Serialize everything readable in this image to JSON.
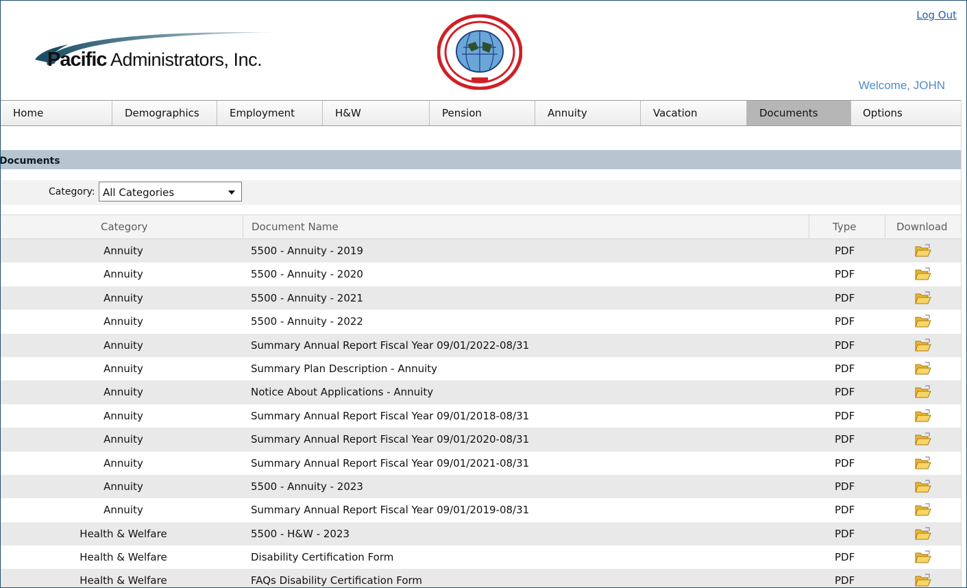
{
  "header": {
    "logo_bold": "Pacific",
    "logo_rest": " Administrators, Inc.",
    "logout": "Log Out",
    "welcome": "Welcome, JOHN"
  },
  "nav": [
    {
      "label": "Home",
      "active": false
    },
    {
      "label": "Demographics",
      "active": false
    },
    {
      "label": "Employment",
      "active": false
    },
    {
      "label": "H&W",
      "active": false
    },
    {
      "label": "Pension",
      "active": false
    },
    {
      "label": "Annuity",
      "active": false
    },
    {
      "label": "Vacation",
      "active": false
    },
    {
      "label": "Documents",
      "active": true
    },
    {
      "label": "Options",
      "active": false
    }
  ],
  "section": {
    "title": "Documents"
  },
  "filter": {
    "label": "Category:",
    "value": "All Categories"
  },
  "table": {
    "headers": {
      "category": "Category",
      "name": "Document Name",
      "type": "Type",
      "download": "Download"
    },
    "rows": [
      {
        "category": "Annuity",
        "name": "5500 - Annuity - 2019",
        "type": "PDF"
      },
      {
        "category": "Annuity",
        "name": "5500 - Annuity - 2020",
        "type": "PDF"
      },
      {
        "category": "Annuity",
        "name": "5500 - Annuity - 2021",
        "type": "PDF"
      },
      {
        "category": "Annuity",
        "name": "5500 - Annuity - 2022",
        "type": "PDF"
      },
      {
        "category": "Annuity",
        "name": "Summary Annual Report Fiscal Year 09/01/2022-08/31",
        "type": "PDF"
      },
      {
        "category": "Annuity",
        "name": "Summary Plan Description - Annuity",
        "type": "PDF"
      },
      {
        "category": "Annuity",
        "name": "Notice About Applications - Annuity",
        "type": "PDF"
      },
      {
        "category": "Annuity",
        "name": "Summary Annual Report Fiscal Year 09/01/2018-08/31",
        "type": "PDF"
      },
      {
        "category": "Annuity",
        "name": "Summary Annual Report Fiscal Year 09/01/2020-08/31",
        "type": "PDF"
      },
      {
        "category": "Annuity",
        "name": "Summary Annual Report Fiscal Year 09/01/2021-08/31",
        "type": "PDF"
      },
      {
        "category": "Annuity",
        "name": "5500 - Annuity - 2023",
        "type": "PDF"
      },
      {
        "category": "Annuity",
        "name": "Summary Annual Report Fiscal Year 09/01/2019-08/31",
        "type": "PDF"
      },
      {
        "category": "Health & Welfare",
        "name": "5500 - H&W - 2023",
        "type": "PDF"
      },
      {
        "category": "Health & Welfare",
        "name": "Disability Certification Form",
        "type": "PDF"
      },
      {
        "category": "Health & Welfare",
        "name": "FAQs Disability Certification Form",
        "type": "PDF"
      }
    ]
  },
  "colors": {
    "section_bar": "#b7c5d0",
    "nav_active": "#b6b6b6",
    "link": "#1f5fb5",
    "welcome": "#4f8cc9",
    "row_alt": "#e9e9e9"
  },
  "icons": {
    "download": "open-folder-icon",
    "select": "caret-down-icon"
  }
}
